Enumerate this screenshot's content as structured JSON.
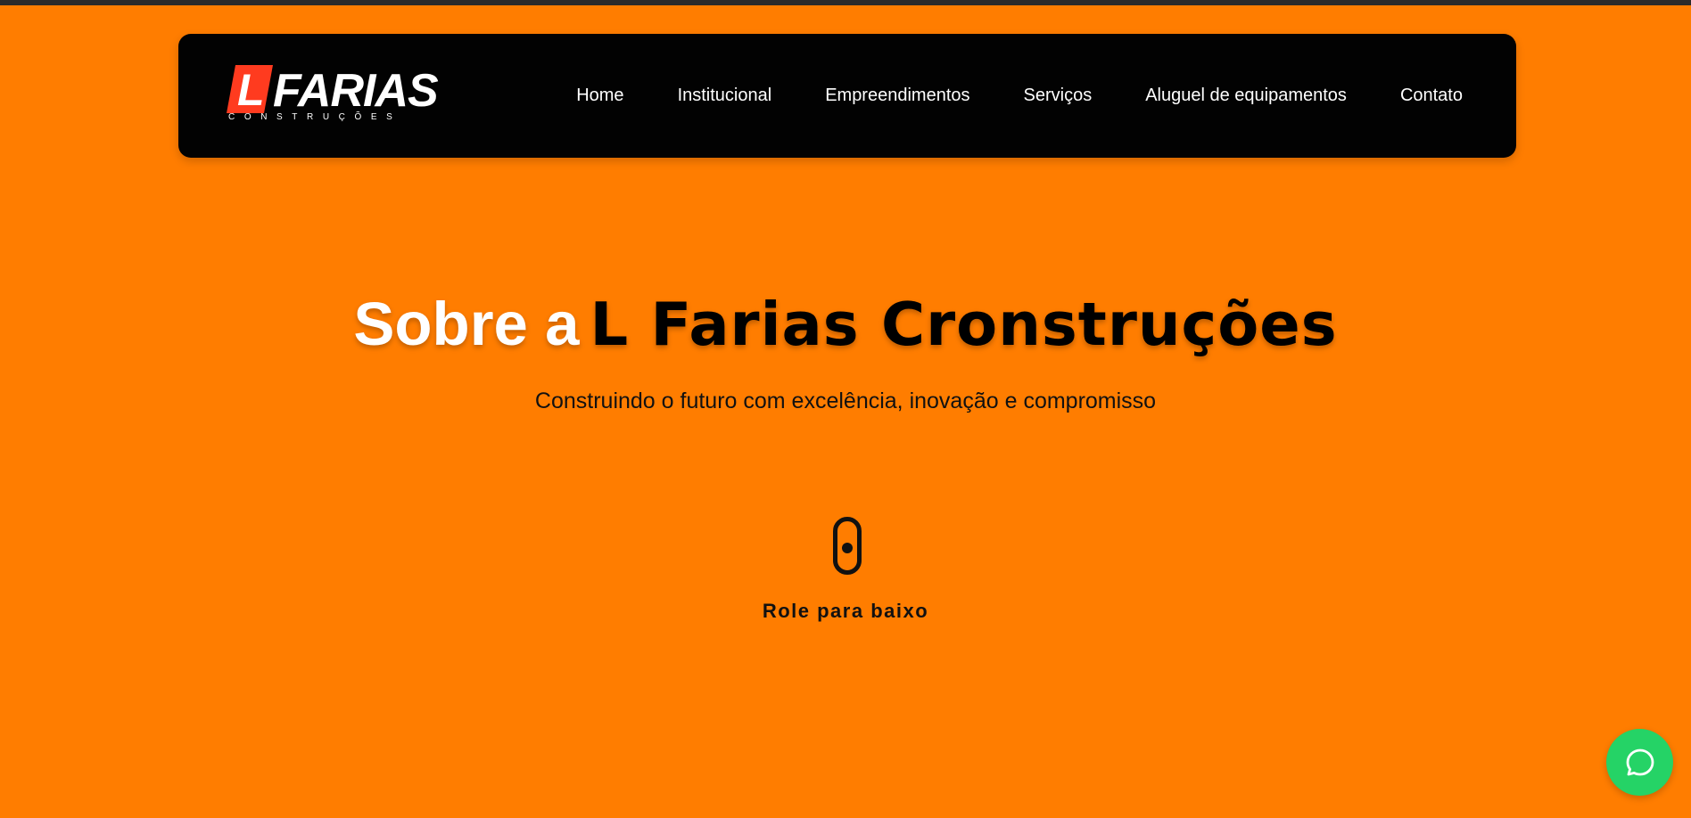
{
  "brand": {
    "logo_letter": "L",
    "logo_name": "FARIAS",
    "logo_tagline": "CONSTRUÇÕES",
    "accent_color": "#ff7d00",
    "logo_red": "#ff3b1f"
  },
  "nav": {
    "items": [
      {
        "label": "Home"
      },
      {
        "label": "Institucional"
      },
      {
        "label": "Empreendimentos"
      },
      {
        "label": "Serviços"
      },
      {
        "label": "Aluguel de equipamentos"
      },
      {
        "label": "Contato"
      }
    ]
  },
  "hero": {
    "title_prefix": "Sobre a",
    "title_highlight": "L Farias Cronstruções",
    "subtitle": "Construindo o futuro com excelência, inovação e compromisso",
    "scroll_label": "Role para baixo",
    "scroll_icon": "mouse-scroll-icon"
  },
  "chat": {
    "icon": "whatsapp-chat-icon",
    "color": "#25d366"
  }
}
